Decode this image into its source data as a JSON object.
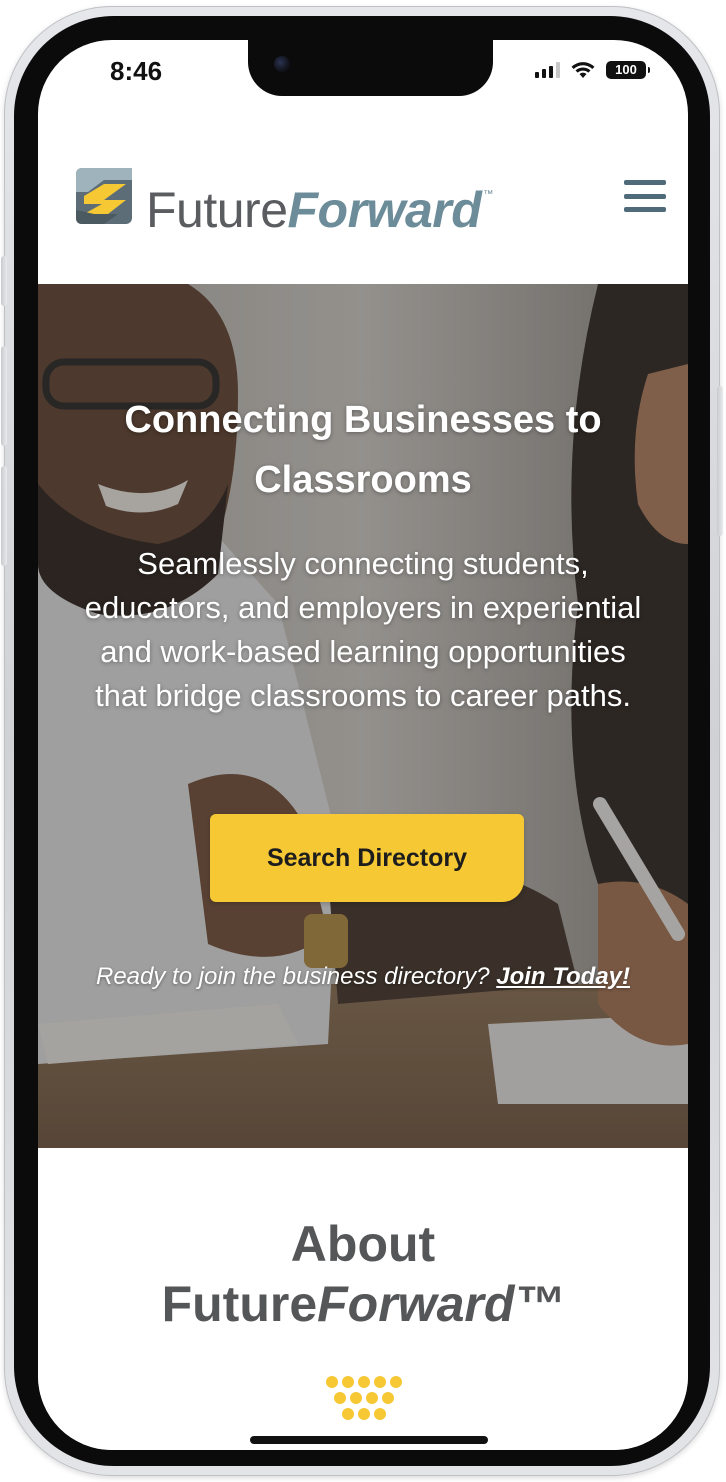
{
  "status_bar": {
    "time": "8:46",
    "battery": "100"
  },
  "header": {
    "logo_part1": "Future",
    "logo_part2": "Forward",
    "logo_tm": "™",
    "menu_icon": "hamburger-menu-icon"
  },
  "hero": {
    "title": "Connecting Businesses to Classrooms",
    "subtitle": "Seamlessly connecting students, educators, and employers in experiential and work-based learning opportunities that bridge classrooms to career paths.",
    "cta_label": "Search Directory",
    "join_prompt": "Ready to join the business directory?",
    "join_link": "Join Today!"
  },
  "about": {
    "title_line1": "About",
    "title_part1": "Future",
    "title_part2": "Forward™"
  },
  "colors": {
    "accent_yellow": "#f6c833",
    "logo_blue": "#6c8c99",
    "logo_gray": "#5a5c60",
    "menu_icon": "#4f6a78",
    "heading_gray": "#555658"
  }
}
